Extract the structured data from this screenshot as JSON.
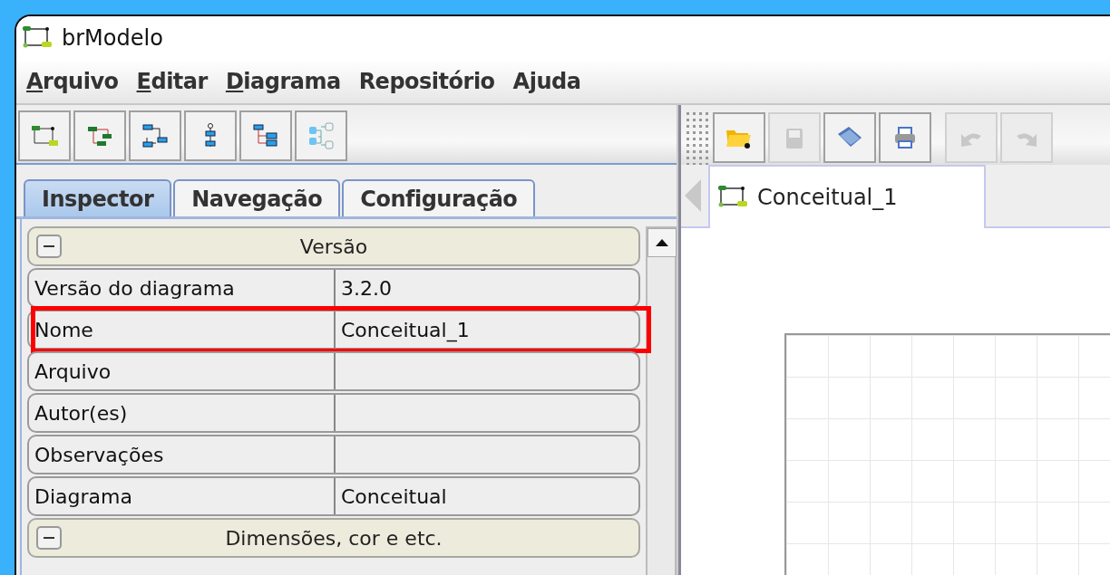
{
  "window": {
    "title": "brModelo"
  },
  "menu": [
    {
      "label": "Arquivo",
      "underline_first": true
    },
    {
      "label": "Editar",
      "underline_first": true
    },
    {
      "label": "Diagrama",
      "underline_first": true
    },
    {
      "label": "Repositório",
      "underline_first": false
    },
    {
      "label": "Ajuda",
      "underline_first": false
    }
  ],
  "left_toolbar": [
    {
      "kind": "conceptual"
    },
    {
      "kind": "logical"
    },
    {
      "kind": "flow"
    },
    {
      "kind": "sequence"
    },
    {
      "kind": "tree"
    },
    {
      "kind": "mindmap"
    }
  ],
  "tabs": [
    {
      "label": "Inspector",
      "selected": true
    },
    {
      "label": "Navegação",
      "selected": false
    },
    {
      "label": "Configuração",
      "selected": false
    }
  ],
  "inspector": [
    {
      "kind": "section",
      "title": "Versão",
      "expanded": true
    },
    {
      "kind": "property",
      "name": "Versão do diagrama",
      "value": "3.2.0",
      "highlighted": false
    },
    {
      "kind": "property",
      "name": "Nome",
      "value": "Conceitual_1",
      "highlighted": true
    },
    {
      "kind": "property",
      "name": "Arquivo",
      "highlighted": false
    },
    {
      "kind": "property",
      "name": "Autor(es)",
      "highlighted": false
    },
    {
      "kind": "property",
      "name": "Observações",
      "highlighted": false
    },
    {
      "kind": "property",
      "name": "Diagrama",
      "value": "Conceitual",
      "highlighted": false
    },
    {
      "kind": "section",
      "title": "Dimensões, cor e etc.",
      "expanded": true
    }
  ],
  "right_toolbar": [
    {
      "kind": "open",
      "disabled": false
    },
    {
      "kind": "save",
      "disabled": true
    },
    {
      "kind": "folder",
      "disabled": false
    },
    {
      "kind": "print",
      "disabled": false
    },
    {
      "kind": "undo",
      "disabled": true
    },
    {
      "kind": "redo",
      "disabled": true
    }
  ],
  "documents": [
    {
      "label": "Conceitual_1",
      "selected": true
    }
  ]
}
